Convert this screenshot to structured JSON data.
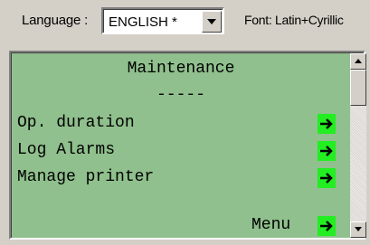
{
  "toolbar": {
    "language_label": "Language :",
    "language_value": "ENGLISH *",
    "font_label": "Font: Latin+Cyrillic"
  },
  "screen": {
    "title": "Maintenance",
    "separator": "-----",
    "items": [
      {
        "label": "Op. duration",
        "icon": "right-arrow-icon"
      },
      {
        "label": "Log Alarms",
        "icon": "right-arrow-icon"
      },
      {
        "label": "Manage printer",
        "icon": "right-arrow-icon"
      }
    ],
    "footer_label": "Menu"
  },
  "colors": {
    "screen_bg": "#90c08d",
    "arrow_bg": "#22ee22",
    "window_bg": "#d4d0c8"
  }
}
